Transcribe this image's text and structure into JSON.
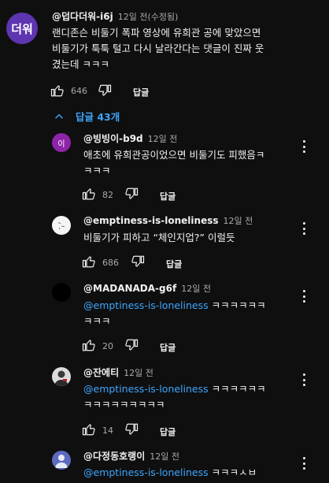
{
  "main_comment": {
    "avatar_text": "더워",
    "author": "@덥다더워-i6j",
    "time": "12일 전(수정됨)",
    "lines": [
      "랜디존슨 비둘기 폭파 영상에 유희관 공에 맞았으면",
      "비둘기가 툭툭 털고 다시 날라간다는 댓글이 진짜 웃",
      "겼는데 ㅋㅋㅋ"
    ],
    "likes": "646",
    "reply_label": "답글"
  },
  "replies_toggle": {
    "label": "답글 43개"
  },
  "replies": [
    {
      "avatar_text": "이",
      "author": "@빙빙이-b9d",
      "time": "12일 전",
      "lines": [
        "애초에 유희관공이었으면 비둘기도 피했음ㅋ",
        "ㅋㅋㅋ"
      ],
      "likes": "82",
      "reply_label": "답글"
    },
    {
      "author": "@emptiness-is-loneliness",
      "time": "12일 전",
      "lines": [
        "비둘기가 피하고 “체인지업?” 이럴듯"
      ],
      "likes": "686",
      "reply_label": "답글"
    },
    {
      "author": "@MADANADA-g6f",
      "time": "12일 전",
      "mention": "@emptiness-is-loneliness",
      "line1_rest": " ㅋㅋㅋㅋㅋㅋ",
      "line2": "ㅋㅋㅋ",
      "likes": "20",
      "reply_label": "답글"
    },
    {
      "author": "@잔에티",
      "time": "12일 전",
      "mention": "@emptiness-is-loneliness",
      "line1_rest": " ㅋㅋㅋㅋㅋㅋ",
      "line2": "ㅋㅋㅋㅋㅋㅋㅋㅋㅋ",
      "likes": "14",
      "reply_label": "답글"
    },
    {
      "author": "@다정동호랭이",
      "time": "12일 전",
      "mention": "@emptiness-is-loneliness",
      "line1_rest": " ㅋㅋㅋㅅㅂ"
    }
  ],
  "colors": {
    "background": "#0f0f0f",
    "link": "#3ea6ff",
    "main_avatar": "#5e35b1",
    "reply1_avatar": "#8e24aa",
    "reply5_avatar": "#5c6bc0"
  },
  "icons": [
    "thumb-up-icon",
    "thumb-down-icon",
    "chevron-up-icon",
    "more-vert-icon"
  ]
}
